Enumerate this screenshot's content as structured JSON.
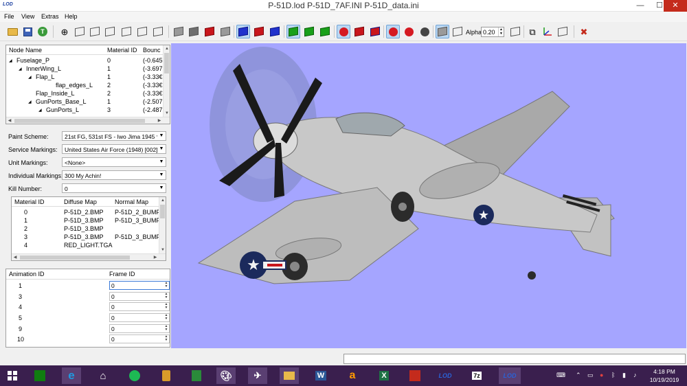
{
  "window": {
    "title": "P-51D.lod  P-51D_7AF.INI  P-51D_data.ini",
    "app_icon_text": "LOD",
    "min_glyph": "—",
    "max_glyph": "☐",
    "close_glyph": "✕"
  },
  "menu": [
    "File",
    "View",
    "Extras",
    "Help"
  ],
  "toolbar": {
    "icons": [
      "open-folder",
      "save-disk",
      "texture-t",
      "zoom-view",
      "wire-cube-1",
      "wire-cube-2",
      "wire-cube-3",
      "wire-cube-4",
      "wire-cube-5",
      "wire-cube-6",
      "solid-grey-cube",
      "solid-dark-cube",
      "red-cube",
      "grey-cube",
      "blue-wire-cube",
      "red-wire-cube",
      "blue-solid-cube",
      "green-red-cube",
      "green-cube",
      "green-solid-cube",
      "red-sphere",
      "red-gem",
      "color-cube",
      "red-ball-pressed",
      "red-bug",
      "grey-bug",
      "grey-box-pressed"
    ],
    "alpha_label": "Alpha:",
    "alpha_value": "0.20",
    "right_icons": [
      "screenshot",
      "axes",
      "wire-box",
      "tools"
    ]
  },
  "node_tree": {
    "columns": [
      "Node Name",
      "Material ID",
      "Bounc"
    ],
    "rows": [
      {
        "name": "Fuselage_P",
        "expander": "◢",
        "material": "0",
        "bounds": "(-0.645"
      },
      {
        "name": "InnerWing_L",
        "expander": "◢",
        "material": "1",
        "bounds": "(-3.697"
      },
      {
        "name": "Flap_L",
        "expander": "◢",
        "material": "1",
        "bounds": "(-3.33€"
      },
      {
        "name": "flap_edges_L",
        "expander": "",
        "material": "2",
        "bounds": "(-3.33€"
      },
      {
        "name": "Flap_Inside_L",
        "expander": "",
        "material": "2",
        "bounds": "(-3.33€"
      },
      {
        "name": "GunPorts_Base_L",
        "expander": "◢",
        "material": "1",
        "bounds": "(-2.507"
      },
      {
        "name": "GunPorts_L",
        "expander": "◢",
        "material": "3",
        "bounds": "(-2.487"
      }
    ]
  },
  "markings": {
    "paint_scheme": {
      "label": "Paint Scheme:",
      "value": "21st FG, 531st FS - Iwo Jima 1945 *"
    },
    "service_markings": {
      "label": "Service Markings:",
      "value": "United States Air Force (1948) [002]"
    },
    "unit_markings": {
      "label": "Unit Markings:",
      "value": "<None>"
    },
    "individual_markings": {
      "label": "Individual Markings:",
      "value": "300 My Achin!"
    },
    "kill_number": {
      "label": "Kill Number:",
      "value": "0"
    }
  },
  "materials": {
    "columns": [
      "Material ID",
      "Diffuse Map",
      "Normal Map"
    ],
    "rows": [
      {
        "id": "0",
        "diffuse": "P-51D_2.BMP",
        "normal": "P-51D_2_BUMP."
      },
      {
        "id": "1",
        "diffuse": "P-51D_3.BMP",
        "normal": "P-51D_3_BUMP."
      },
      {
        "id": "2",
        "diffuse": "P-51D_3.BMP",
        "normal": ""
      },
      {
        "id": "3",
        "diffuse": "P-51D_3.BMP",
        "normal": "P-51D_3_BUMP."
      },
      {
        "id": "4",
        "diffuse": "RED_LIGHT.TGA",
        "normal": ""
      }
    ]
  },
  "animations": {
    "columns": [
      "Animation ID",
      "Frame ID"
    ],
    "rows": [
      {
        "id": "1",
        "frame": "0"
      },
      {
        "id": "3",
        "frame": "0"
      },
      {
        "id": "4",
        "frame": "0"
      },
      {
        "id": "5",
        "frame": "0"
      },
      {
        "id": "9",
        "frame": "0"
      },
      {
        "id": "10",
        "frame": "0"
      }
    ]
  },
  "viewport": {
    "background": "#a5a5ff",
    "insignia_star": "★"
  },
  "taskbar": {
    "apps": [
      "windows-start",
      "store",
      "internet-explorer",
      "home",
      "spotify",
      "notes",
      "calculator",
      "paint",
      "fighter-jet",
      "file-explorer",
      "word",
      "amazon",
      "excel",
      "acrobat",
      "lod-tool",
      "7zip",
      "lod-tool-active"
    ],
    "labels": {
      "word": "W",
      "amazon": "a",
      "excel": "X",
      "lod": "LOD",
      "sevenzip": "7z"
    },
    "clock_time": "4:18 PM",
    "clock_date": "10/19/2019"
  }
}
